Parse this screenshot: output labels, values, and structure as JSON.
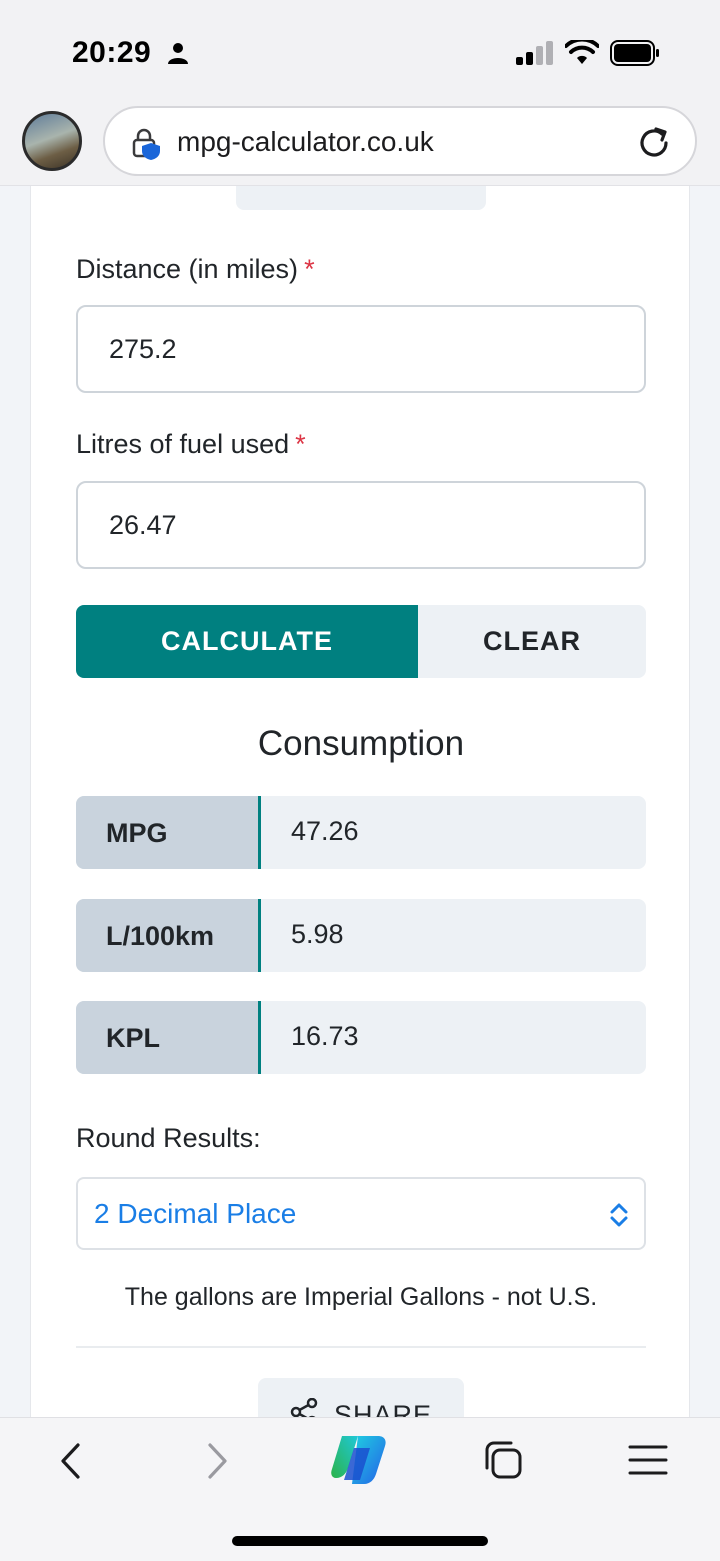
{
  "status_bar": {
    "time": "20:29"
  },
  "address_bar": {
    "url": "mpg-calculator.co.uk"
  },
  "form": {
    "distance_label": "Distance (in miles)",
    "distance_value": "275.2",
    "litres_label": "Litres of fuel used",
    "litres_value": "26.47",
    "required_mark": "*",
    "calculate_label": "CALCULATE",
    "clear_label": "CLEAR"
  },
  "results": {
    "title": "Consumption",
    "rows": [
      {
        "label": "MPG",
        "value": "47.26"
      },
      {
        "label": "L/100km",
        "value": "5.98"
      },
      {
        "label": "KPL",
        "value": "16.73"
      }
    ]
  },
  "rounding": {
    "label": "Round Results:",
    "selected": "2 Decimal Place"
  },
  "note": "The gallons are Imperial Gallons - not U.S.",
  "share_label": "SHARE",
  "colors": {
    "accent": "#008080",
    "required": "#dc3545",
    "select_text": "#1a7ee6"
  },
  "icons": [
    "person-icon",
    "signal-icon",
    "wifi-icon",
    "battery-icon",
    "lock-shield-icon",
    "reload-icon",
    "share-icon",
    "back-icon",
    "forward-icon",
    "copilot-icon",
    "tabs-icon",
    "menu-icon"
  ]
}
